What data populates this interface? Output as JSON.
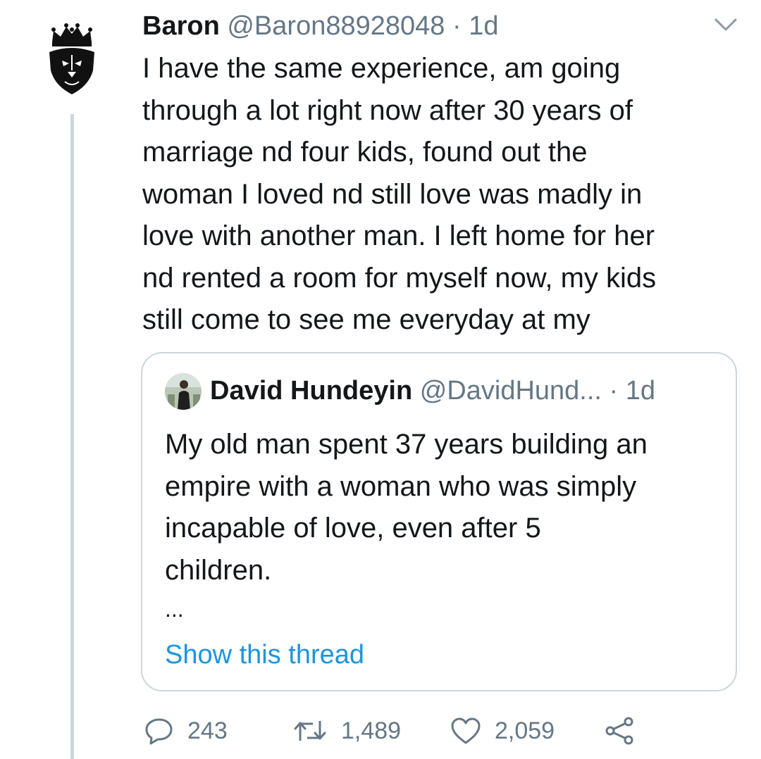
{
  "tweet": {
    "author_name": "Baron",
    "author_handle": "@Baron88928048",
    "separator": "·",
    "time": "1d",
    "avatar_icon": "crowned-lion-icon",
    "text": "I have the same experience, am going\nthrough a lot right now after 30 years of\nmarriage nd four kids, found out the\nwoman I loved nd still love was madly in\nlove with another man. I left home for her\nnd rented a room for myself now, my kids\nstill come to see me everyday at my"
  },
  "quoted_tweet": {
    "author_name": "David Hundeyin",
    "author_handle": "@DavidHund...",
    "separator": "·",
    "time": "1d",
    "text": "My old man spent 37 years building an\nempire with a woman who was simply\nincapable of love, even after 5\nchildren.",
    "ellipsis": "...",
    "show_thread_label": "Show this thread"
  },
  "actions": {
    "replies": "243",
    "retweets": "1,489",
    "likes": "2,059",
    "reply_icon": "reply-icon",
    "retweet_icon": "retweet-icon",
    "like_icon": "heart-icon",
    "share_icon": "share-icon",
    "menu_icon": "chevron-down-icon"
  },
  "colors": {
    "text": "#14171a",
    "muted": "#657786",
    "link": "#1b95e0",
    "border": "#ccd6dd"
  }
}
